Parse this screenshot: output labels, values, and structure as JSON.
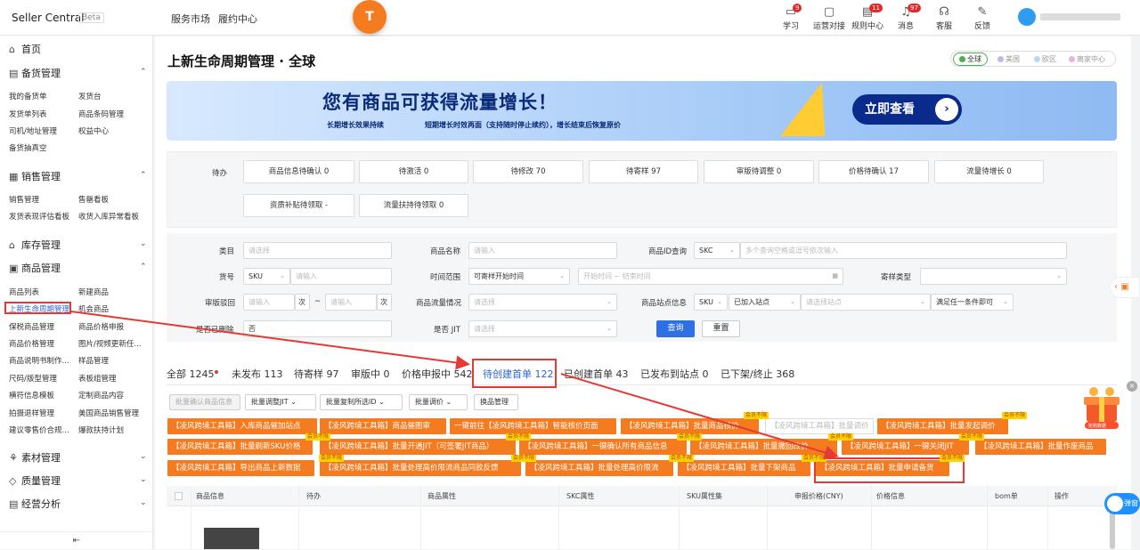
{
  "top": {
    "logo": "Seller Central",
    "beta": "Beta",
    "nav": [
      "服务市场",
      "履约中心"
    ],
    "orange": "T",
    "icons": [
      {
        "label": "学习",
        "badge": "9"
      },
      {
        "label": "运营对接",
        "badge": ""
      },
      {
        "label": "规则中心",
        "badge": "11"
      },
      {
        "label": "消息",
        "badge": "97"
      },
      {
        "label": "客服",
        "badge": ""
      },
      {
        "label": "反馈",
        "badge": ""
      }
    ]
  },
  "sidebar": {
    "home": "首页",
    "groups": [
      "备货管理",
      "销售管理",
      "库存管理",
      "商品管理",
      "素材管理",
      "质量管理",
      "经营分析"
    ],
    "items": {
      "stock": [
        "我的备货单",
        "发货台",
        "发货单列表",
        "商品条码管理",
        "司机/地址管理",
        "权益中心",
        "备货抽真空"
      ],
      "sales": [
        "销售管理",
        "售罄看板",
        "发货表现评估看板",
        "收货入库异常看板"
      ],
      "goods": [
        "商品列表",
        "新建商品",
        "上新生命周期管理",
        "机会商品",
        "保税商品管理",
        "商品价格申报",
        "商品价格管理",
        "图片/视频更新任...",
        "商品说明书制作...",
        "样品管理",
        "尺码/版型管理",
        "表板组管理",
        "横符信息模板",
        "定制商品内容",
        "拍摄退样管理",
        "美国商品销售管理",
        "建议零售价合规...",
        "爆款扶持计划"
      ]
    }
  },
  "title": "上新生命周期管理 · 全球",
  "regions": [
    "全球",
    "美国",
    "欧区",
    "离家中心"
  ],
  "banner": {
    "headline": "您有商品可获得流量增长！",
    "line1": "长期增长效果持续",
    "line2": "短期增长时效再面（支持随时停止续约），增长结束后恢复原价",
    "cta": "立即查看"
  },
  "todo": {
    "label": "待办",
    "cards": [
      "商品信息待确认 0",
      "待激活 0",
      "待修改 70",
      "待寄样 97",
      "审版待调整 0",
      "价格待确认 17",
      "流量待增长 0",
      "资质补贴待领取 -",
      "流量扶持待领取 0"
    ]
  },
  "filters": {
    "labels": [
      "类目",
      "货号",
      "审版驳回",
      "是否已删除",
      "商品名称",
      "时间范围",
      "商品流量情况",
      "是否 JIT",
      "商品ID查询",
      "寄样类型",
      "商品站点信息"
    ],
    "category_ph": "请选择",
    "sku_sel": "SKU",
    "sku_ph": "请输入",
    "reject_ph": "请输入",
    "reject_unit": "次",
    "reject_sep": "~",
    "reject_ph2": "请输入",
    "deleted_val": "否",
    "name_ph": "请输入",
    "time_sel": "可寄样开始时间",
    "time_ph": "开始时间 ~ 结束时间",
    "flow_ph": "请选择",
    "jit_ph": "请选择",
    "id_sel": "SKC",
    "id_ph": "多个查询空格或逗号依次输入",
    "sample_ph": "",
    "site_sel": "SKU",
    "site_val": "已加入站点",
    "site_ph": "请选择站点",
    "site_cond": "满足任一条件即可",
    "query": "查询",
    "reset": "重置"
  },
  "tabs": [
    "全部 1245",
    "未发布 113",
    "待寄样 97",
    "审版中 0",
    "价格申报中 542",
    "待创建首单 122",
    "已创建首单 43",
    "已发布到站点 0",
    "已下架/终止 368"
  ],
  "toolbar": [
    "批量确认商品信息",
    "批量调整JIT",
    "批量复制所选ID",
    "批量调价",
    "换品管理"
  ],
  "orange": [
    "【凌风跨境工具箱】入库商品催加站点",
    "【凌风跨境工具箱】商品催图审",
    "一键前往【凌风跨境工具箱】智能核价页面",
    "【凌风跨境工具箱】批量商品核价",
    "【凌风跨境工具箱】批量调价",
    "【凌风跨境工具箱】批量发起调价",
    "【凌风跨境工具箱】批量刷新SKU价格",
    "【凌风跨境工具箱】批量开通JIT（可签署JIT商品）",
    "【凌风跨境工具箱】一键确认所有商品信息",
    "【凌风跨境工具箱】批量撤回改价",
    "【凌风跨境工具箱】一键关闭JIT",
    "【凌风跨境工具箱】批量作废商品",
    "【凌风跨境工具箱】导出商品上新数据",
    "【凌风跨境工具箱】批量处理高价限流商品同款反馈",
    "【凌风跨境工具箱】批量处理高价限流",
    "【凌风跨境工具箱】批量下架商品",
    "【凌风跨境工具箱】批量申请备货"
  ],
  "vip": "会员不限",
  "table": {
    "cols": [
      "商品信息",
      "待办",
      "商品属性",
      "SKC属性",
      "SKU属性集",
      "申报价格(CNY)",
      "价格信息",
      "bom单",
      "操作"
    ]
  },
  "float": {
    "toggle": "弹窗",
    "gift": "抢购数据"
  },
  "colors": {
    "accent": "#2b63d9",
    "orange": "#f47b20",
    "red": "#e53935"
  }
}
